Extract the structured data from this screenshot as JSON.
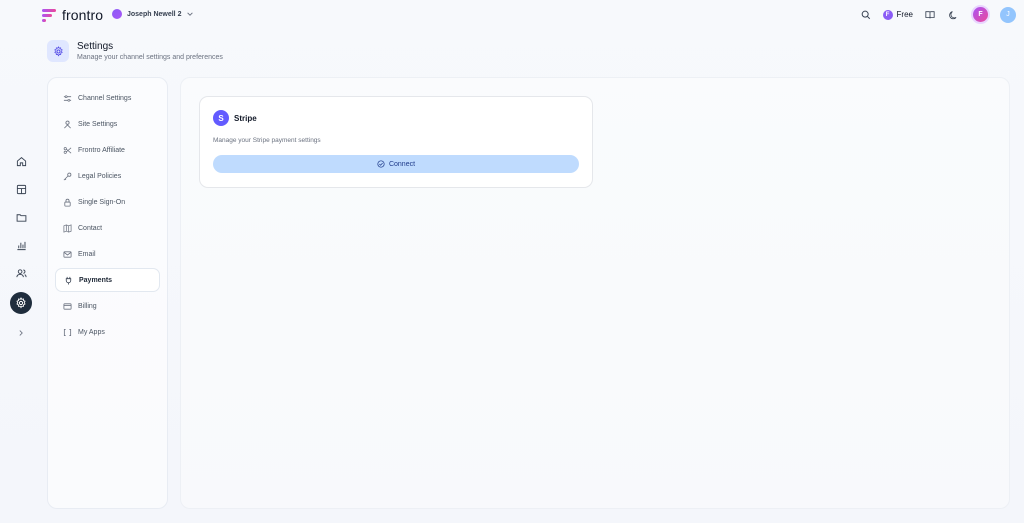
{
  "app": {
    "name": "frontro"
  },
  "channel": {
    "name": "Joseph Newell 2"
  },
  "header_right": {
    "plan_label": "Free",
    "plan_badge": "F",
    "brand_avatar": "F",
    "user_avatar": "J"
  },
  "page": {
    "title": "Settings",
    "subtitle": "Manage your channel settings and preferences"
  },
  "rail": {
    "items": [
      {
        "icon": "home-icon"
      },
      {
        "icon": "layout-icon"
      },
      {
        "icon": "folder-icon"
      },
      {
        "icon": "bar-chart-icon"
      },
      {
        "icon": "users-icon"
      },
      {
        "icon": "gear-icon",
        "active": true
      },
      {
        "icon": "chevron-right-icon"
      }
    ]
  },
  "nav": {
    "items": [
      {
        "label": "Channel Settings",
        "icon": "sliders-icon"
      },
      {
        "label": "Site Settings",
        "icon": "user-icon"
      },
      {
        "label": "Frontro Affiliate",
        "icon": "affiliate-icon"
      },
      {
        "label": "Legal Policies",
        "icon": "key-icon"
      },
      {
        "label": "Single Sign-On",
        "icon": "lock-icon"
      },
      {
        "label": "Contact",
        "icon": "map-icon"
      },
      {
        "label": "Email",
        "icon": "mail-icon"
      },
      {
        "label": "Payments",
        "icon": "plug-icon",
        "active": true
      },
      {
        "label": "Billing",
        "icon": "credit-card-icon"
      },
      {
        "label": "My Apps",
        "icon": "apps-icon"
      }
    ]
  },
  "stripe_card": {
    "badge": "S",
    "title": "Stripe",
    "description": "Manage your Stripe payment settings",
    "connect_label": "Connect"
  },
  "colors": {
    "accent": "#635bff",
    "connect_bg": "#bfdbfe",
    "rail_active": "#1f2d3d"
  }
}
